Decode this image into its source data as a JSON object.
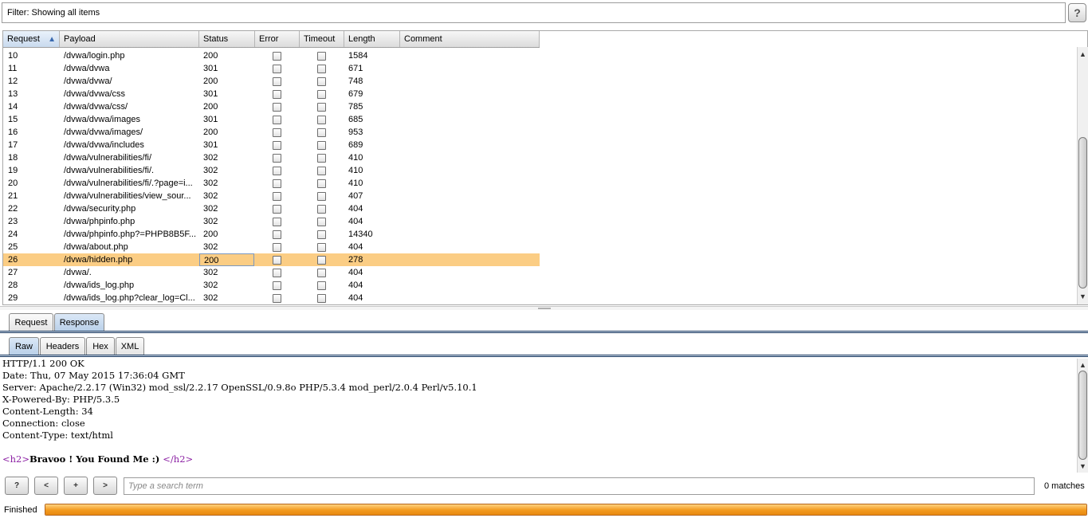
{
  "filter": {
    "text": "Filter: Showing all items",
    "help_label": "?"
  },
  "table": {
    "columns": [
      "Request",
      "Payload",
      "Status",
      "Error",
      "Timeout",
      "Length",
      "Comment"
    ],
    "sorted_column": "Request",
    "rows": [
      {
        "request": "10",
        "payload": "/dvwa/login.php",
        "status": "200",
        "length": "1584"
      },
      {
        "request": "11",
        "payload": "/dvwa/dvwa",
        "status": "301",
        "length": "671"
      },
      {
        "request": "12",
        "payload": "/dvwa/dvwa/",
        "status": "200",
        "length": "748"
      },
      {
        "request": "13",
        "payload": "/dvwa/dvwa/css",
        "status": "301",
        "length": "679"
      },
      {
        "request": "14",
        "payload": "/dvwa/dvwa/css/",
        "status": "200",
        "length": "785"
      },
      {
        "request": "15",
        "payload": "/dvwa/dvwa/images",
        "status": "301",
        "length": "685"
      },
      {
        "request": "16",
        "payload": "/dvwa/dvwa/images/",
        "status": "200",
        "length": "953"
      },
      {
        "request": "17",
        "payload": "/dvwa/dvwa/includes",
        "status": "301",
        "length": "689"
      },
      {
        "request": "18",
        "payload": "/dvwa/vulnerabilities/fi/",
        "status": "302",
        "length": "410"
      },
      {
        "request": "19",
        "payload": "/dvwa/vulnerabilities/fi/.",
        "status": "302",
        "length": "410"
      },
      {
        "request": "20",
        "payload": "/dvwa/vulnerabilities/fi/.?page=i...",
        "status": "302",
        "length": "410"
      },
      {
        "request": "21",
        "payload": "/dvwa/vulnerabilities/view_sour...",
        "status": "302",
        "length": "407"
      },
      {
        "request": "22",
        "payload": "/dvwa/security.php",
        "status": "302",
        "length": "404"
      },
      {
        "request": "23",
        "payload": "/dvwa/phpinfo.php",
        "status": "302",
        "length": "404"
      },
      {
        "request": "24",
        "payload": "/dvwa/phpinfo.php?=PHPB8B5F...",
        "status": "200",
        "length": "14340"
      },
      {
        "request": "25",
        "payload": "/dvwa/about.php",
        "status": "302",
        "length": "404"
      },
      {
        "request": "26",
        "payload": "/dvwa/hidden.php",
        "status": "200",
        "length": "278"
      },
      {
        "request": "27",
        "payload": "/dvwa/.",
        "status": "302",
        "length": "404"
      },
      {
        "request": "28",
        "payload": "/dvwa/ids_log.php",
        "status": "302",
        "length": "404"
      },
      {
        "request": "29",
        "payload": "/dvwa/ids_log.php?clear_log=Cl...",
        "status": "302",
        "length": "404"
      }
    ],
    "selected_request": "26"
  },
  "message_tabs": [
    "Request",
    "Response"
  ],
  "active_message_tab": "Response",
  "view_tabs": [
    "Raw",
    "Headers",
    "Hex",
    "XML"
  ],
  "active_view_tab": "Raw",
  "response": {
    "headers": [
      "HTTP/1.1 200 OK",
      "Date: Thu, 07 May 2015 17:36:04 GMT",
      "Server: Apache/2.2.17 (Win32) mod_ssl/2.2.17 OpenSSL/0.9.8o PHP/5.3.4 mod_perl/2.0.4 Perl/v5.10.1",
      "X-Powered-By: PHP/5.3.5",
      "Content-Length: 34",
      "Connection: close",
      "Content-Type: text/html"
    ],
    "body_open_tag": "<h2>",
    "body_text": "Bravoo ! You Found Me :) ",
    "body_close_tag": "</h2>"
  },
  "search": {
    "help_label": "?",
    "prev_label": "<",
    "add_label": "+",
    "next_label": ">",
    "placeholder": "Type a search term",
    "matches": "0 matches"
  },
  "status": {
    "label": "Finished",
    "progress": 1.0
  },
  "colors": {
    "selected_row": "#fbcd84",
    "progress": "#f39a1e",
    "tag": "#8b1fa3"
  }
}
